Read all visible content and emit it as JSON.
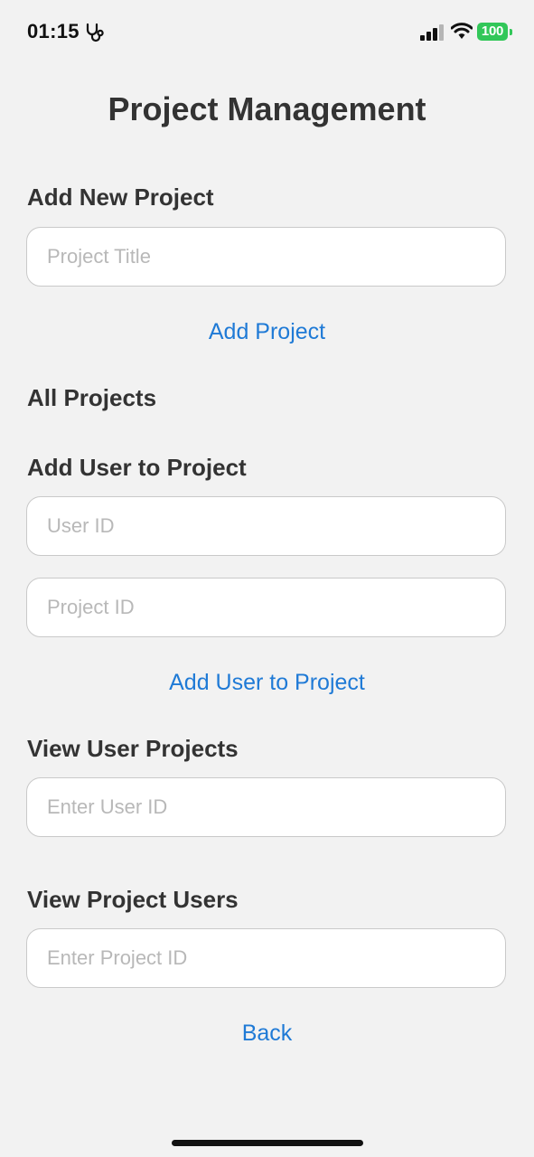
{
  "status_bar": {
    "time": "01:15",
    "battery": "100",
    "icons": {
      "activity": "stethoscope-icon",
      "signal": "cellular-signal-icon",
      "wifi": "wifi-icon",
      "battery": "battery-icon"
    },
    "battery_color": "#32c759"
  },
  "page": {
    "title": "Project Management"
  },
  "add_project": {
    "heading": "Add New Project",
    "title_placeholder": "Project Title",
    "button": "Add Project"
  },
  "all_projects": {
    "heading": "All Projects"
  },
  "add_user": {
    "heading": "Add User to Project",
    "user_placeholder": "User ID",
    "project_placeholder": "Project ID",
    "button": "Add User to Project"
  },
  "view_user_projects": {
    "heading": "View User Projects",
    "placeholder": "Enter User ID"
  },
  "view_project_users": {
    "heading": "View Project Users",
    "placeholder": "Enter Project ID"
  },
  "navigation": {
    "back": "Back"
  },
  "colors": {
    "accent": "#1f7ad6",
    "background": "#f2f2f2",
    "heading_text": "#333333"
  }
}
